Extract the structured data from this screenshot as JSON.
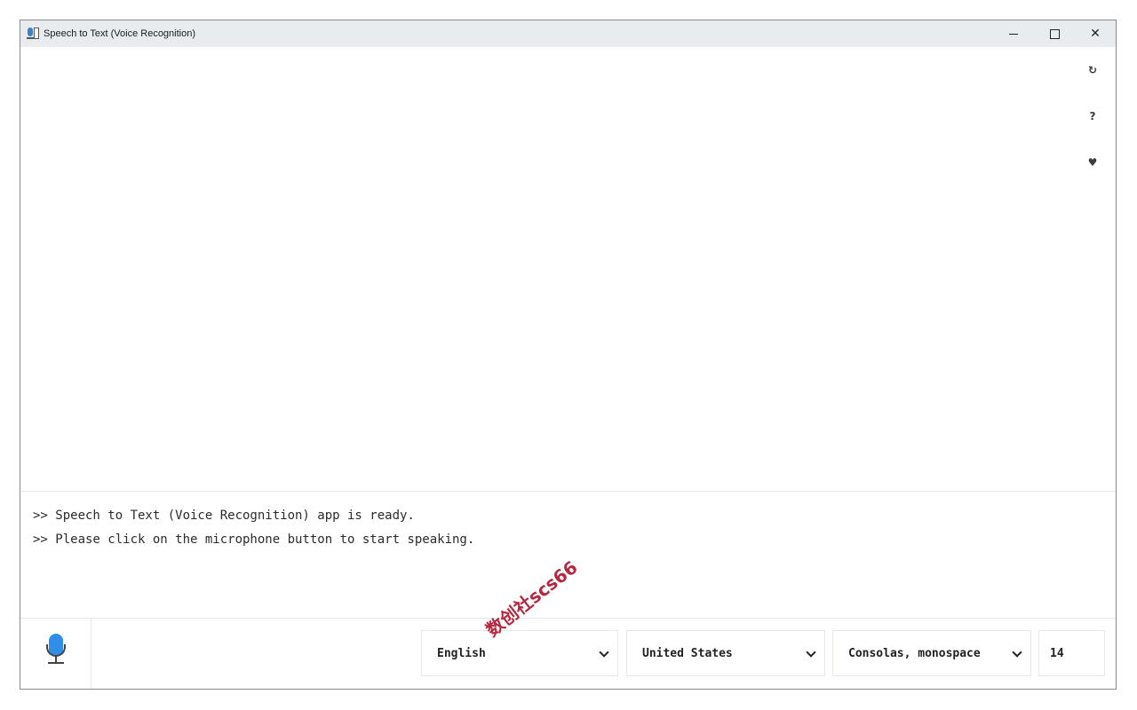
{
  "window": {
    "title": "Speech to Text (Voice Recognition)"
  },
  "side_tools": [
    {
      "icon": "refresh-icon",
      "glyph": "↻"
    },
    {
      "icon": "help-icon",
      "glyph": "?"
    },
    {
      "icon": "heart-icon",
      "glyph": "♥"
    }
  ],
  "log": {
    "lines": [
      ">> Speech to Text (Voice Recognition) app is ready.",
      ">> Please click on the microphone button to start speaking."
    ]
  },
  "controls": {
    "language": "English",
    "region": "United States",
    "font": "Consolas, monospace",
    "font_size": "14"
  },
  "watermark": "数创社scs66",
  "colors": {
    "accent": "#2f8fe8",
    "titlebar": "#e9ecef"
  }
}
